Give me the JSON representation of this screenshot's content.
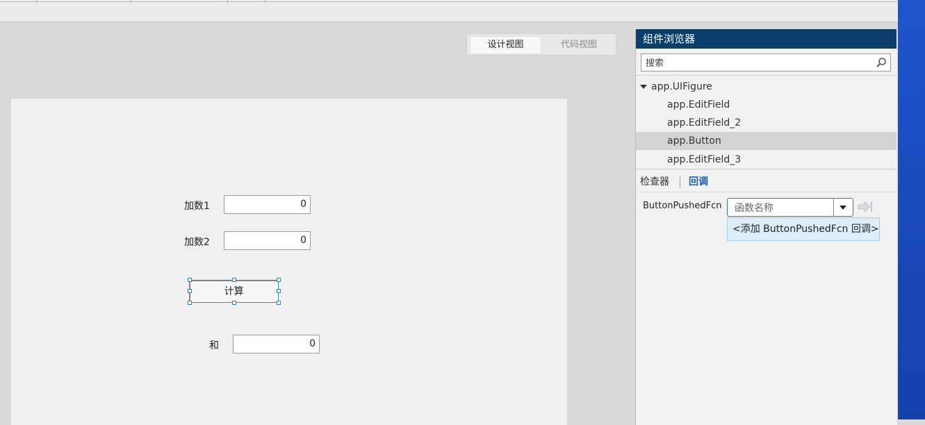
{
  "view_toggle": {
    "design_label": "设计视图",
    "code_label": "代码视图"
  },
  "canvas": {
    "addend1_label": "加数1",
    "addend1_value": "0",
    "addend2_label": "加数2",
    "addend2_value": "0",
    "calc_button_label": "计算",
    "sum_label": "和",
    "sum_value": "0"
  },
  "component_browser": {
    "title": "组件浏览器",
    "search_placeholder": "搜索",
    "tree": {
      "root": "app.UIFigure",
      "children": [
        "app.EditField",
        "app.EditField_2",
        "app.Button",
        "app.EditField_3"
      ],
      "selected": "app.Button"
    },
    "tabs": {
      "inspector": "检查器",
      "callbacks": "回调"
    },
    "callback": {
      "name": "ButtonPushedFcn",
      "placeholder": "函数名称",
      "dropdown_option": "<添加 ButtonPushedFcn 回调>"
    }
  },
  "colors": {
    "panel_header": "#0b3d6b",
    "callbacks_tab": "#1d5fb5",
    "selection": "#2c7fc8",
    "desktop": "#1e55c9"
  }
}
